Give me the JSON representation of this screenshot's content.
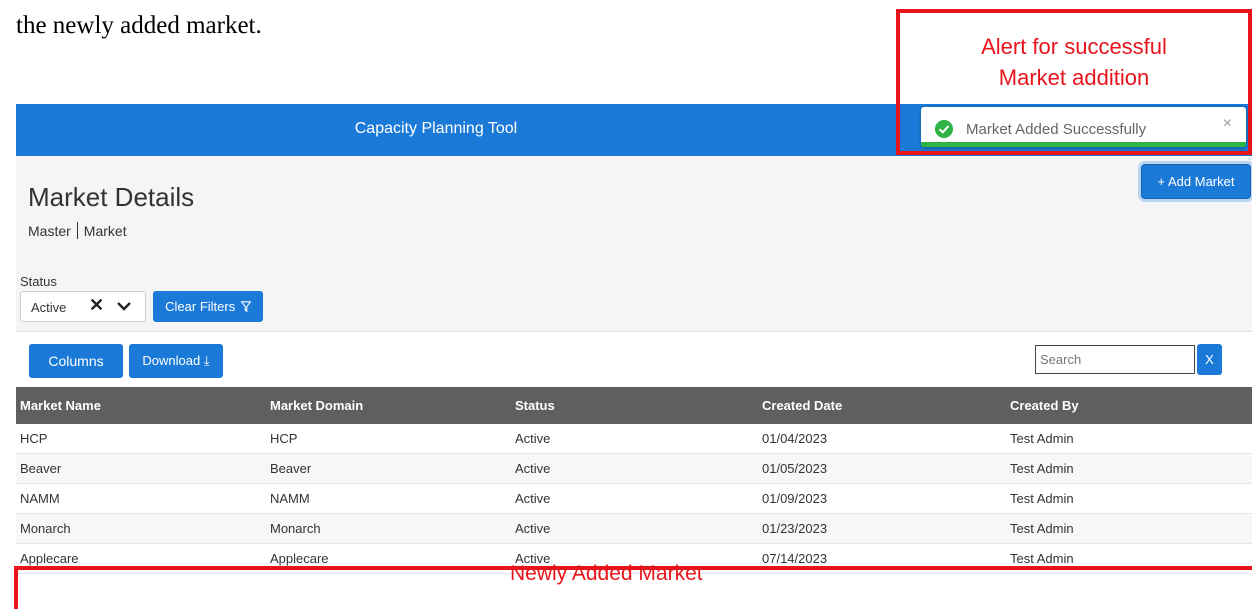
{
  "doc": {
    "caption_text": "the newly added market."
  },
  "header": {
    "title": "Capacity Planning Tool"
  },
  "page": {
    "title": "Market Details",
    "breadcrumb": {
      "parent": "Master",
      "current": "Market"
    },
    "add_button": "+ Add Market"
  },
  "filters": {
    "status_label": "Status",
    "status_value": "Active",
    "clear_filters_label": "Clear Filters",
    "clear_filters_icon": "filter-icon"
  },
  "toolbar": {
    "columns_label": "Columns",
    "download_label": "Download ⤓",
    "search_placeholder": "Search",
    "search_clear_label": "X"
  },
  "table": {
    "columns": [
      "Market Name",
      "Market Domain",
      "Status",
      "Created Date",
      "Created By"
    ],
    "rows": [
      [
        "HCP",
        "HCP",
        "Active",
        "01/04/2023",
        "Test Admin"
      ],
      [
        "Beaver",
        "Beaver",
        "Active",
        "01/05/2023",
        "Test Admin"
      ],
      [
        "NAMM",
        "NAMM",
        "Active",
        "01/09/2023",
        "Test Admin"
      ],
      [
        "Monarch",
        "Monarch",
        "Active",
        "01/23/2023",
        "Test Admin"
      ],
      [
        "Applecare",
        "Applecare",
        "Active",
        "07/14/2023",
        "Test Admin"
      ]
    ]
  },
  "toast": {
    "message": "Market Added Successfully",
    "close_label": "×",
    "icon": "check-circle-icon",
    "progress": 1.0
  },
  "annotations": {
    "alert_label_line1": "Alert for successful",
    "alert_label_line2": "Market addition",
    "new_row_label": "Newly Added Market"
  },
  "colors": {
    "brand_blue": "#1b7ad7",
    "table_header": "#5f5f5f",
    "annotation_red": "#e8141c",
    "success_green": "#2fb344"
  }
}
